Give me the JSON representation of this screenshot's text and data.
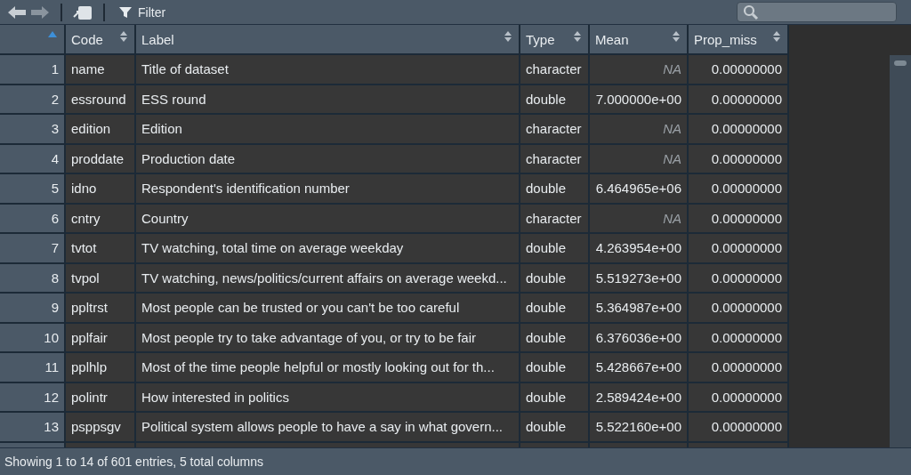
{
  "toolbar": {
    "filter_label": "Filter"
  },
  "columns": [
    {
      "sorted": true
    },
    {
      "label": "Code",
      "sorted": false
    },
    {
      "label": "Label",
      "sorted": false
    },
    {
      "label": "Type",
      "sorted": false
    },
    {
      "label": "Mean",
      "sorted": false
    },
    {
      "label": "Prop_miss",
      "sorted": false
    }
  ],
  "rows": [
    [
      "1",
      "name",
      "Title of dataset",
      "character",
      "NA",
      "0.00000000"
    ],
    [
      "2",
      "essround",
      "ESS round",
      "double",
      "7.000000e+00",
      "0.00000000"
    ],
    [
      "3",
      "edition",
      "Edition",
      "character",
      "NA",
      "0.00000000"
    ],
    [
      "4",
      "proddate",
      "Production date",
      "character",
      "NA",
      "0.00000000"
    ],
    [
      "5",
      "idno",
      "Respondent's identification number",
      "double",
      "6.464965e+06",
      "0.00000000"
    ],
    [
      "6",
      "cntry",
      "Country",
      "character",
      "NA",
      "0.00000000"
    ],
    [
      "7",
      "tvtot",
      "TV watching, total time on average weekday",
      "double",
      "4.263954e+00",
      "0.00000000"
    ],
    [
      "8",
      "tvpol",
      "TV watching, news/politics/current affairs on average weekd...",
      "double",
      "5.519273e+00",
      "0.00000000"
    ],
    [
      "9",
      "ppltrst",
      "Most people can be trusted or you can't be too careful",
      "double",
      "5.364987e+00",
      "0.00000000"
    ],
    [
      "10",
      "pplfair",
      "Most people try to take advantage of you, or try to be fair",
      "double",
      "6.376036e+00",
      "0.00000000"
    ],
    [
      "11",
      "pplhlp",
      "Most of the time people helpful or mostly looking out for th...",
      "double",
      "5.428667e+00",
      "0.00000000"
    ],
    [
      "12",
      "polintr",
      "How interested in politics",
      "double",
      "2.589424e+00",
      "0.00000000"
    ],
    [
      "13",
      "psppsgv",
      "Political system allows people to have a say in what govern...",
      "double",
      "5.522160e+00",
      "0.00000000"
    ]
  ],
  "status_bar": "Showing 1 to 14 of 601 entries, 5 total columns"
}
